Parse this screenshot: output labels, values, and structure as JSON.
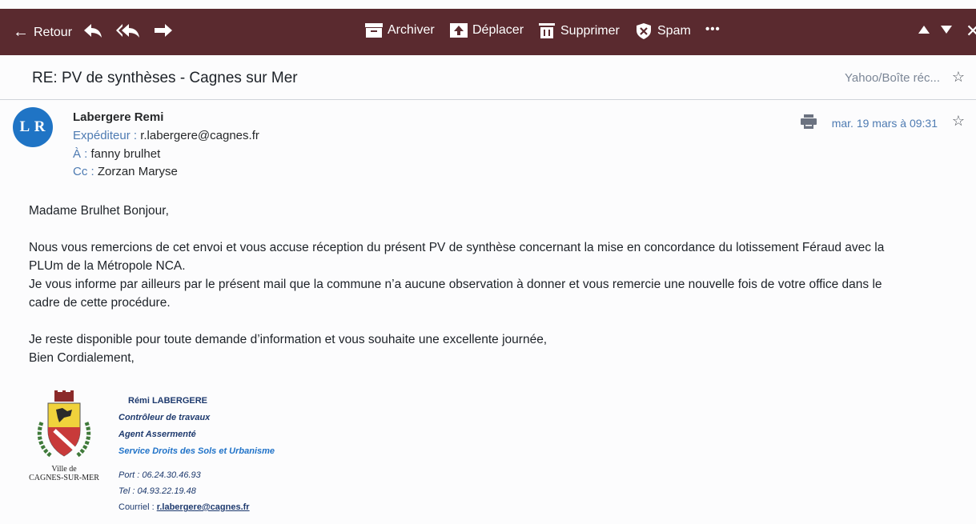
{
  "toolbar": {
    "back_label": "Retour",
    "archive_label": "Archiver",
    "move_label": "Déplacer",
    "delete_label": "Supprimer",
    "spam_label": "Spam",
    "more_label": "•••"
  },
  "message": {
    "subject": "RE: PV de synthèses - Cagnes sur Mer",
    "folder": "Yahoo/Boîte réc...",
    "avatar_initials": "L R",
    "avatar_color": "#1f74c5",
    "sender_name": "Labergere Remi",
    "from_label": "Expéditeur :",
    "from_value": "r.labergere@cagnes.fr",
    "to_label": "À :",
    "to_value": "fanny brulhet",
    "cc_label": "Cc :",
    "cc_value": "Zorzan Maryse",
    "date": "mar. 19 mars à 09:31"
  },
  "body": {
    "greeting": "Madame Brulhet Bonjour,",
    "para1_line1": "Nous vous remercions de cet envoi et vous accuse réception du présent PV de synthèse concernant la mise en concordance du lotissement Féraud avec la",
    "para1_line2": "PLUm de la Métropole NCA.",
    "para1_line3": "Je vous informe par ailleurs par le présent mail que la commune n’a aucune observation à donner et vous remercie une nouvelle fois de votre office dans le",
    "para1_line4": "cadre de cette procédure.",
    "para2_line1": "Je reste disponible pour toute demande d’information et vous souhaite une excellente journée,",
    "para2_line2": "Bien Cordialement,"
  },
  "signature": {
    "name": "Rémi LABERGERE",
    "role1": "Contrôleur de travaux",
    "role2": "Agent Assermenté",
    "service": "Service Droits des Sols et Urbanisme",
    "port": "Port : 06.24.30.46.93",
    "tel": "Tel : 04.93.22.19.48",
    "email_label": "Courriel : ",
    "email": "r.labergere@cagnes.fr",
    "town_line1": "Ville de",
    "town_line2": "CAGNES-SUR-MER"
  },
  "colors": {
    "toolbar_bg": "#5a2a2f",
    "accent": "#4e7bb2"
  }
}
